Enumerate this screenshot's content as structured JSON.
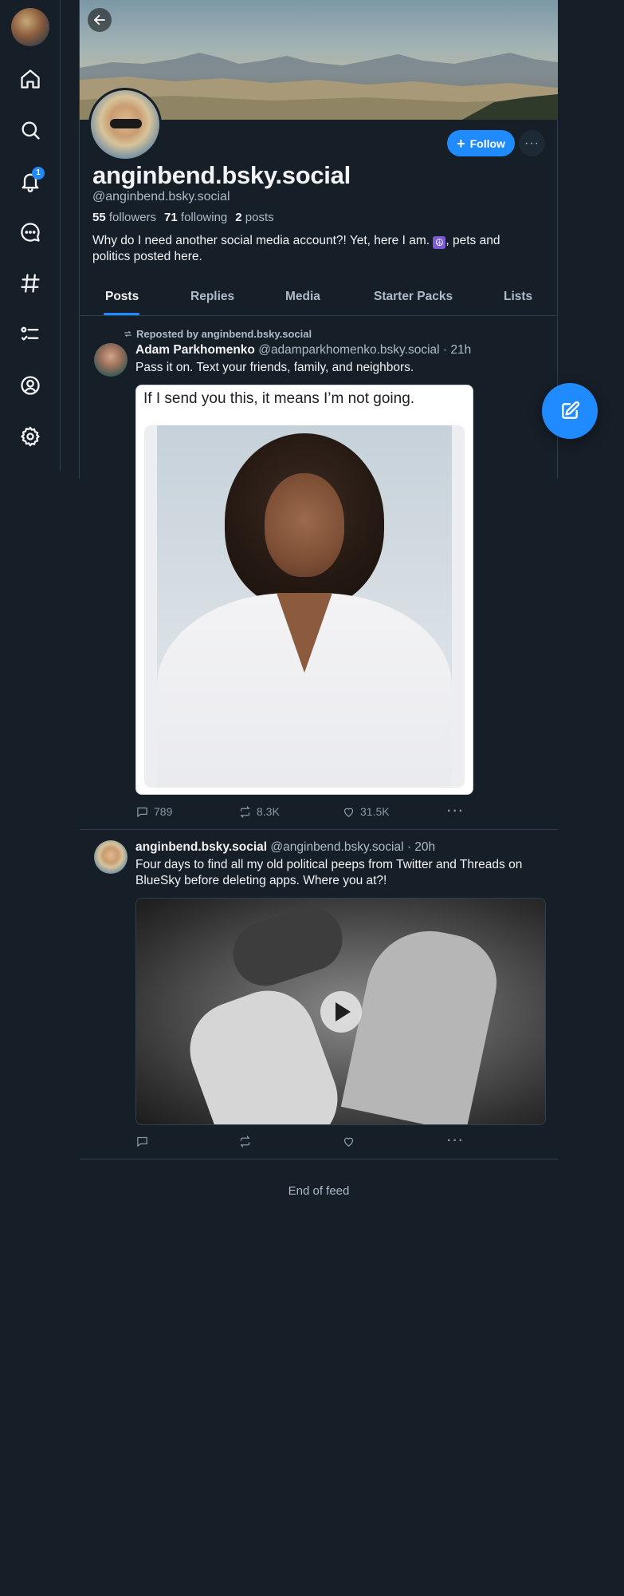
{
  "nav": {
    "items": [
      {
        "icon": "home-icon",
        "badge": ""
      },
      {
        "icon": "search-icon",
        "badge": ""
      },
      {
        "icon": "bell-icon",
        "badge": "1"
      },
      {
        "icon": "chat-icon",
        "badge": ""
      },
      {
        "icon": "hashtag-icon",
        "badge": ""
      },
      {
        "icon": "list-icon",
        "badge": ""
      },
      {
        "icon": "profile-icon",
        "badge": ""
      },
      {
        "icon": "gear-icon",
        "badge": ""
      }
    ]
  },
  "profile": {
    "display_name": "anginbend.bsky.social",
    "handle": "@anginbend.bsky.social",
    "followers_count": "55",
    "followers_label": "followers",
    "following_count": "71",
    "following_label": "following",
    "posts_count": "2",
    "posts_label": "posts",
    "bio_before": "Why do I need another social media account?! Yet, here I am. ",
    "bio_emoji": "☮",
    "bio_after": ", pets and politics posted here.",
    "follow_label": "Follow",
    "more_label": "···"
  },
  "tabs": [
    "Posts",
    "Replies",
    "Media",
    "Starter Packs",
    "Lists"
  ],
  "posts": [
    {
      "repost_label": "Reposted by anginbend.bsky.social",
      "author": "Adam Parkhomenko",
      "meta": "@adamparkhomenko.bsky.social · 21h",
      "text": "Pass it on. Text your friends, family, and neighbors.",
      "image_caption": "If I send you this, it means I’m not going.",
      "replies": "789",
      "reposts": "8.3K",
      "likes": "31.5K"
    },
    {
      "author": "anginbend.bsky.social",
      "meta": "@anginbend.bsky.social · 20h",
      "text": "Four days to find all my old political peeps from Twitter and Threads on BlueSky before deleting apps. Where you at?!",
      "replies": "",
      "reposts": "",
      "likes": ""
    }
  ],
  "end_of_feed": "End of feed",
  "colors": {
    "accent": "#208bfe",
    "background": "#161e27",
    "border": "#2e4052",
    "muted_text": "#aebbc9"
  }
}
